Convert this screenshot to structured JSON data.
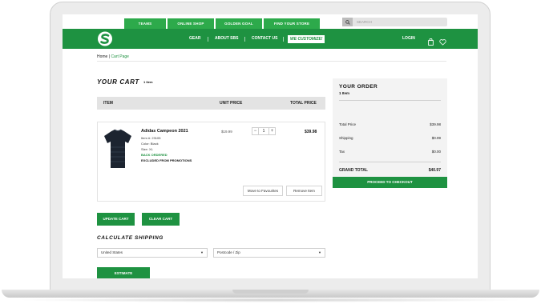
{
  "top_tabs": [
    {
      "label": "TEAMS"
    },
    {
      "label": "ONLINE SHOP"
    },
    {
      "label": "GOLDEN GOAL"
    },
    {
      "label": "FIND YOUR STORE"
    }
  ],
  "search": {
    "placeholder": "SEARCH",
    "icon": "search-icon"
  },
  "nav": {
    "logo_icon": "brand-logo-icon",
    "links": [
      "GEAR",
      "ABOUT SBS",
      "CONTACT US"
    ],
    "customize_label": "WE CUSTOMIZE!",
    "login_label": "LOGIN",
    "bag_icon": "shopping-bag-icon",
    "wishlist_icon": "heart-icon"
  },
  "breadcrumb": {
    "home": "Home",
    "separator": "|",
    "current": "Cart Page"
  },
  "cart": {
    "title": "YOUR CART",
    "count": "1 Item",
    "headers": {
      "item": "ITEM",
      "unit_price": "UNIT PRICE",
      "total_price": "TOTAL PRICE"
    },
    "items": [
      {
        "name": "Adidas Campeon 2021",
        "item_no": "Item #: 23105",
        "color": "Color: Black",
        "size": "Size: XL",
        "status": "BACK ORDERED",
        "note": "EXCLUDED FROM PROMOTIONS",
        "unit_price": "$19.99",
        "qty": "1",
        "qty_minus": "−",
        "qty_plus": "+",
        "total_price": "$39.98",
        "move_label": "Move to Favourites",
        "remove_label": "Remove Item"
      }
    ],
    "update_label": "UPDATE CART",
    "clear_label": "CLEAR CART"
  },
  "shipping": {
    "title": "CALCULATE SHIPPING",
    "country": "United States",
    "postcode_placeholder": "Postcode / Zip",
    "dropdown_arrow": "▼",
    "estimate_label": "ESTIMATE"
  },
  "order": {
    "title": "YOUR ORDER",
    "count": "1 Item",
    "rows": [
      {
        "label": "Total Price",
        "value": "$39.98"
      },
      {
        "label": "Shipping",
        "value": "$0.99"
      },
      {
        "label": "Tax",
        "value": "$0.00"
      }
    ],
    "grand_total_label": "GRAND TOTAL",
    "grand_total_value": "$40.97",
    "checkout_label": "PROCEED TO CHECKOUT"
  },
  "colors": {
    "brand_green": "#1e9241",
    "tab_green": "#2daa4b"
  }
}
